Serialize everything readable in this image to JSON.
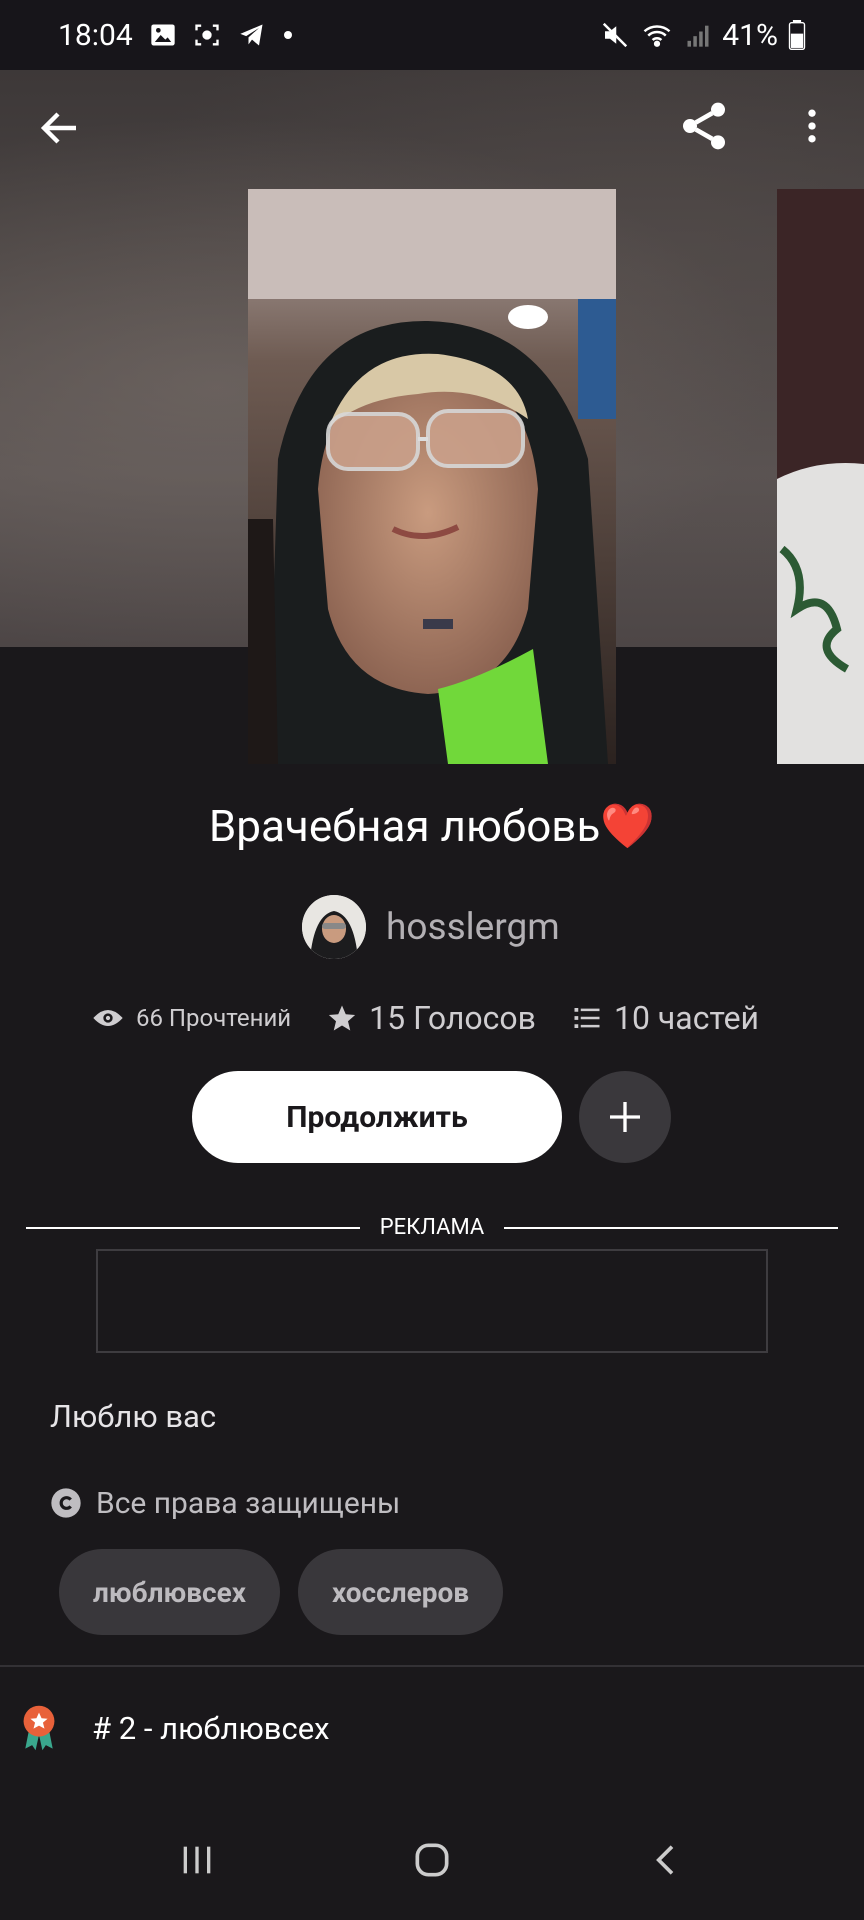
{
  "status_bar": {
    "time": "18:04",
    "battery": "41%"
  },
  "story": {
    "title": "Врачебная любовь❤️",
    "author": "hosslergm",
    "stats": {
      "views": "66 Прочтений",
      "votes": "15 Голосов",
      "parts": "10 частей"
    },
    "continue_label": "Продолжить",
    "ad_label": "РЕКЛАМА",
    "description": "Люблю вас",
    "copyright": "Все права защищены",
    "tags": [
      "люблювсех",
      "хосслеров"
    ],
    "rank": "# 2 - люблювсех"
  },
  "colors": {
    "background": "#1a181b",
    "button_bg": "#ffffff",
    "tag_bg": "#39373b",
    "rank_badge": "#e8613a"
  }
}
